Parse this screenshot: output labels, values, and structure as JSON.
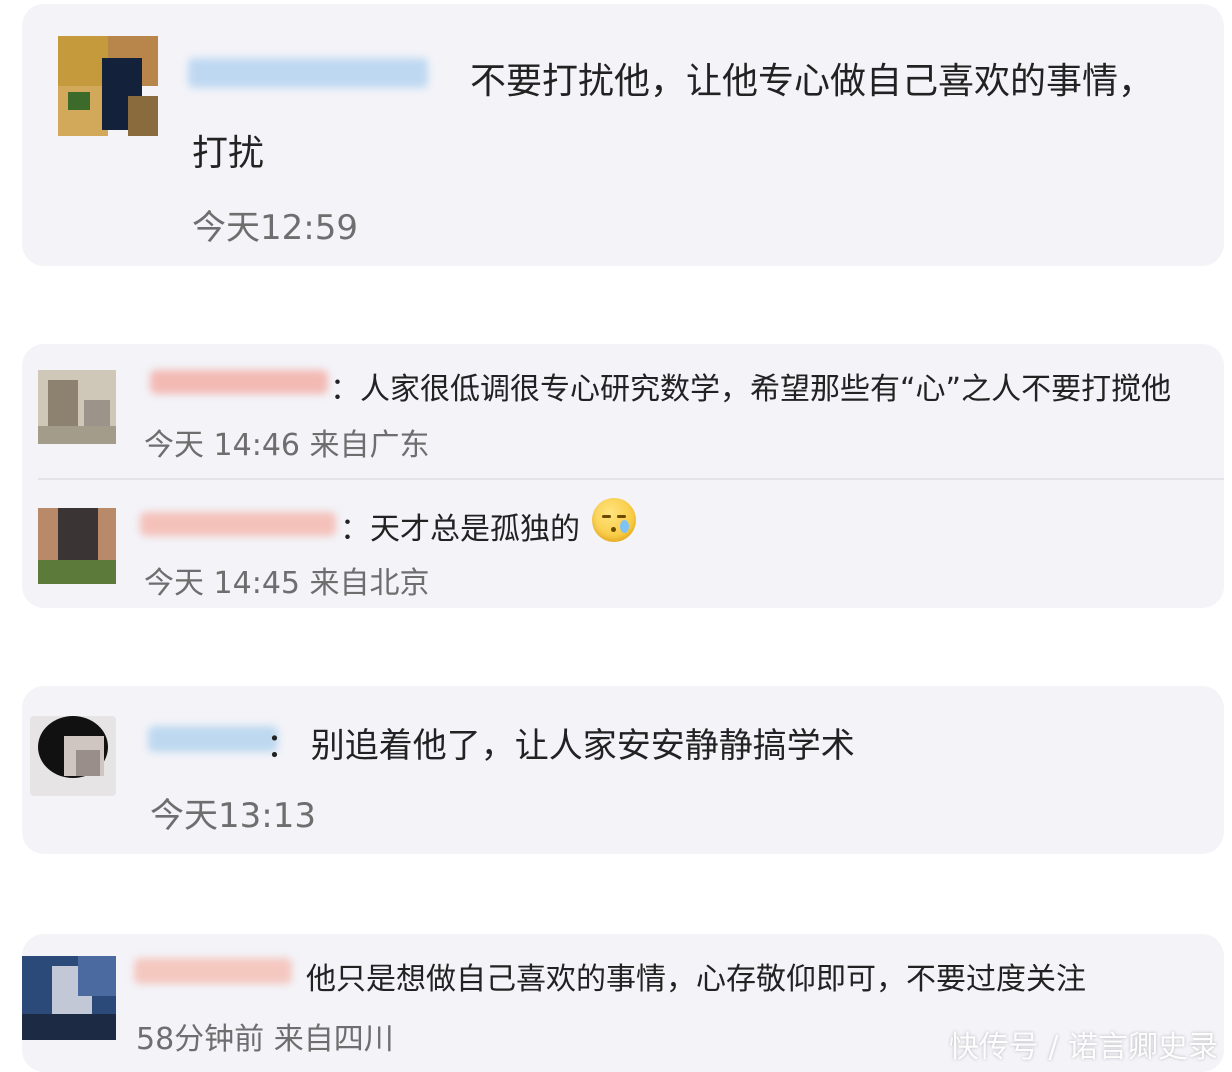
{
  "comments": [
    {
      "text": "不要打扰他，让他专心做自己喜欢的事情，",
      "text_cont": "打扰",
      "time": "今天12:59"
    },
    {
      "replies": [
        {
          "text": "：人家很低调很专心研究数学，希望那些有“心”之人不要打搅他",
          "time": "今天 14:46 来自广东"
        },
        {
          "text": "：天才总是孤独的",
          "emoji": "cold-sweat-emoji",
          "time": "今天 14:45 来自北京"
        }
      ]
    },
    {
      "text": "：  别追着他了，让人家安安静静搞学术",
      "time": "今天13:13"
    },
    {
      "text": "他只是想做自己喜欢的事情，心存敬仰即可，不要过度关注",
      "time": "58分钟前 来自四川"
    }
  ],
  "watermark": "快传号 / 诺言卿史录",
  "colors": {
    "card_bg": "#f3f3f8",
    "text": "#222222",
    "time": "#6e6e6e"
  }
}
